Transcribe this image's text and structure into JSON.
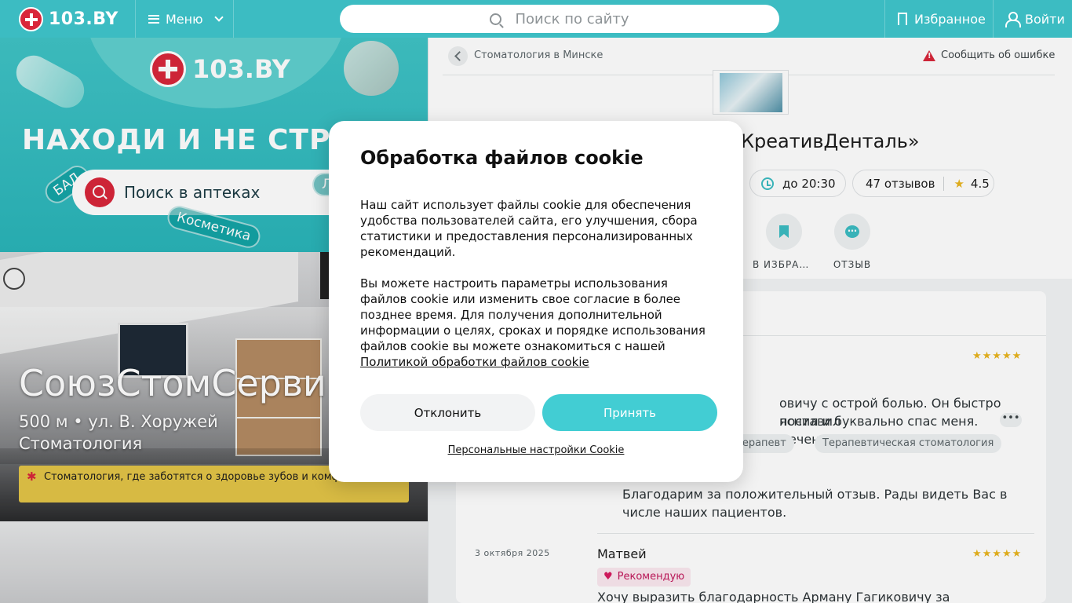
{
  "header": {
    "logo_text": "103.BY",
    "menu_label": "Меню",
    "search_placeholder": "Поиск по сайту",
    "favorites_label": "Избранное",
    "login_label": "Войти",
    "brand_color": "#3cbcc2"
  },
  "banner": {
    "logo_text": "103.BY",
    "slogan": "НАХОДИ И НЕ СТРА",
    "search_label": "Поиск в аптеках",
    "tags": [
      "БАД",
      "Косметика",
      "Л"
    ]
  },
  "place": {
    "name": "СоюзСтомСерви",
    "address": "500 м • ул. В. Хоружей",
    "category": "Стоматология",
    "promo": "Стоматология, где заботятся о здоровье зубов и комф пациента"
  },
  "clinic": {
    "breadcrumb": "Стоматология в Минске",
    "report_label": "Сообщить об ошибке",
    "title": "КреативДенталь»",
    "hours": "до 20:30",
    "reviews_count": "47 отзывов",
    "rating": "4.5",
    "actions": {
      "favorite": "В ИЗБРАН…",
      "review": "ОТЗЫВ"
    }
  },
  "reviews": {
    "first": {
      "text_line1": "овичу с острой болью. Он быстро поставил",
      "text_line2": "яснил и буквально спас меня. Лечение…",
      "more": "•••",
      "chips": [
        "т-терапевт",
        "Терапевтическая стоматология"
      ],
      "reply": "Благодарим за положительный отзыв. Рады видеть Вас в числе наших пациентов."
    },
    "second": {
      "date": "3 октября 2025",
      "author": "Матвей",
      "badge": "Рекомендую",
      "text": "Хочу выразить благодарность Арману Гагиковичу за"
    },
    "stars": "★★★★★"
  },
  "cookie_modal": {
    "title": "Обработка файлов cookie",
    "paragraph1": "Наш сайт использует файлы cookie для обеспечения удобства пользователей сайта, его улучшения, сбора статистики и предоставления персонализированных рекомендаций.",
    "paragraph2": "Вы можете настроить параметры использования файлов cookie или изменить свое согласие в более позднее время. Для получения дополнительной информации о целях, сроках и порядке использования файлов cookie вы можете ознакомиться с нашей",
    "policy_link": "Политикой обработки файлов cookie",
    "decline_label": "Отклонить",
    "accept_label": "Принять",
    "settings_link": "Персональные настройки Cookie",
    "accept_color": "#42cdd3"
  }
}
